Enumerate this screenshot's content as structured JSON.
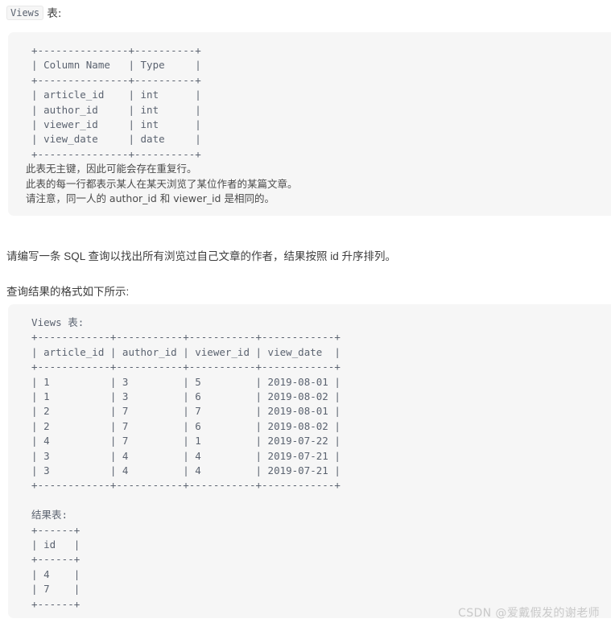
{
  "intro": {
    "code_badge": "Views",
    "suffix": " 表:"
  },
  "schema_block": {
    "ascii_table": "  +---------------+----------+\n  | Column Name   | Type     |\n  +---------------+----------+\n  | article_id    | int      |\n  | author_id     | int      |\n  | viewer_id     | int      |\n  | view_date     | date     |\n  +---------------+----------+",
    "notes": "  此表无主键，因此可能会存在重复行。\n  此表的每一行都表示某人在某天浏览了某位作者的某篇文章。\n  请注意，同一人的 author_id 和 viewer_id 是相同的。",
    "columns": [
      {
        "name": "article_id",
        "type": "int"
      },
      {
        "name": "author_id",
        "type": "int"
      },
      {
        "name": "viewer_id",
        "type": "int"
      },
      {
        "name": "view_date",
        "type": "date"
      }
    ],
    "header": {
      "col1": "Column Name",
      "col2": "Type"
    }
  },
  "question": {
    "line1": "请编写一条 SQL 查询以找出所有浏览过自己文章的作者，结果按照 id 升序排列。",
    "line2": "查询结果的格式如下所示:"
  },
  "example_block": {
    "views_title": "Views 表:",
    "views_ascii": "  Views 表:\n  +------------+-----------+-----------+------------+\n  | article_id | author_id | viewer_id | view_date  |\n  +------------+-----------+-----------+------------+\n  | 1          | 3         | 5         | 2019-08-01 |\n  | 1          | 3         | 6         | 2019-08-02 |\n  | 2          | 7         | 7         | 2019-08-01 |\n  | 2          | 7         | 6         | 2019-08-02 |\n  | 4          | 7         | 1         | 2019-07-22 |\n  | 3          | 4         | 4         | 2019-07-21 |\n  | 3          | 4         | 4         | 2019-07-21 |\n  +------------+-----------+-----------+------------+",
    "result_ascii": "  结果表:\n  +------+\n  | id   |\n  +------+\n  | 4    |\n  | 7    |\n  +------+",
    "result_title": "结果表:",
    "views_headers": [
      "article_id",
      "author_id",
      "viewer_id",
      "view_date"
    ],
    "views_rows": [
      [
        "1",
        "3",
        "5",
        "2019-08-01"
      ],
      [
        "1",
        "3",
        "6",
        "2019-08-02"
      ],
      [
        "2",
        "7",
        "7",
        "2019-08-01"
      ],
      [
        "2",
        "7",
        "6",
        "2019-08-02"
      ],
      [
        "4",
        "7",
        "1",
        "2019-07-22"
      ],
      [
        "3",
        "4",
        "4",
        "2019-07-21"
      ],
      [
        "3",
        "4",
        "4",
        "2019-07-21"
      ]
    ],
    "result_header": "id",
    "result_rows": [
      "4",
      "7"
    ]
  },
  "watermark": {
    "text": "CSDN @爱戴假发的谢老师"
  },
  "colors": {
    "code_background": "#f6f6f6",
    "code_text": "#5b6370",
    "body_text": "#3d3d3d",
    "watermark": "#c9c9c9"
  }
}
